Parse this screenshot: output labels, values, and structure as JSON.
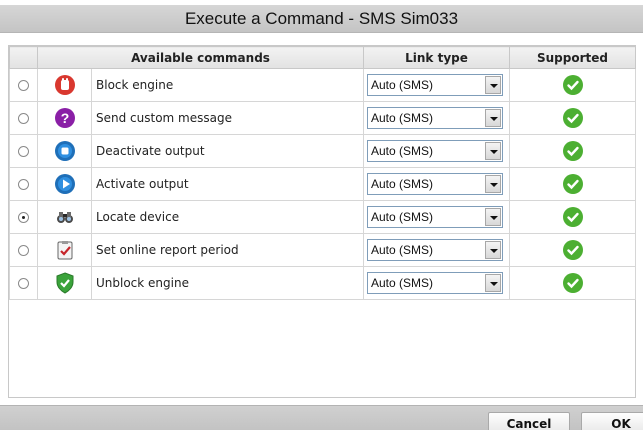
{
  "dialog": {
    "title": "Execute a Command - SMS Sim033"
  },
  "table": {
    "headers": {
      "commands": "Available commands",
      "link_type": "Link type",
      "supported": "Supported"
    },
    "rows": [
      {
        "icon": "stop-hand-icon",
        "command": "Block engine",
        "link_type": "Auto (SMS)",
        "selected": false
      },
      {
        "icon": "question-mark-icon",
        "command": "Send custom message",
        "link_type": "Auto (SMS)",
        "selected": false
      },
      {
        "icon": "stop-circle-icon",
        "command": "Deactivate output",
        "link_type": "Auto (SMS)",
        "selected": false
      },
      {
        "icon": "play-circle-icon",
        "command": "Activate output",
        "link_type": "Auto (SMS)",
        "selected": false
      },
      {
        "icon": "binoculars-icon",
        "command": "Locate device",
        "link_type": "Auto (SMS)",
        "selected": true
      },
      {
        "icon": "clipboard-check-icon",
        "command": "Set online report period",
        "link_type": "Auto (SMS)",
        "selected": false
      },
      {
        "icon": "shield-check-icon",
        "command": "Unblock engine",
        "link_type": "Auto (SMS)",
        "selected": false
      }
    ]
  },
  "buttons": {
    "cancel": "Cancel",
    "ok": "OK"
  },
  "colors": {
    "supported_green": "#4caf32",
    "select_border": "#7f9db9"
  }
}
